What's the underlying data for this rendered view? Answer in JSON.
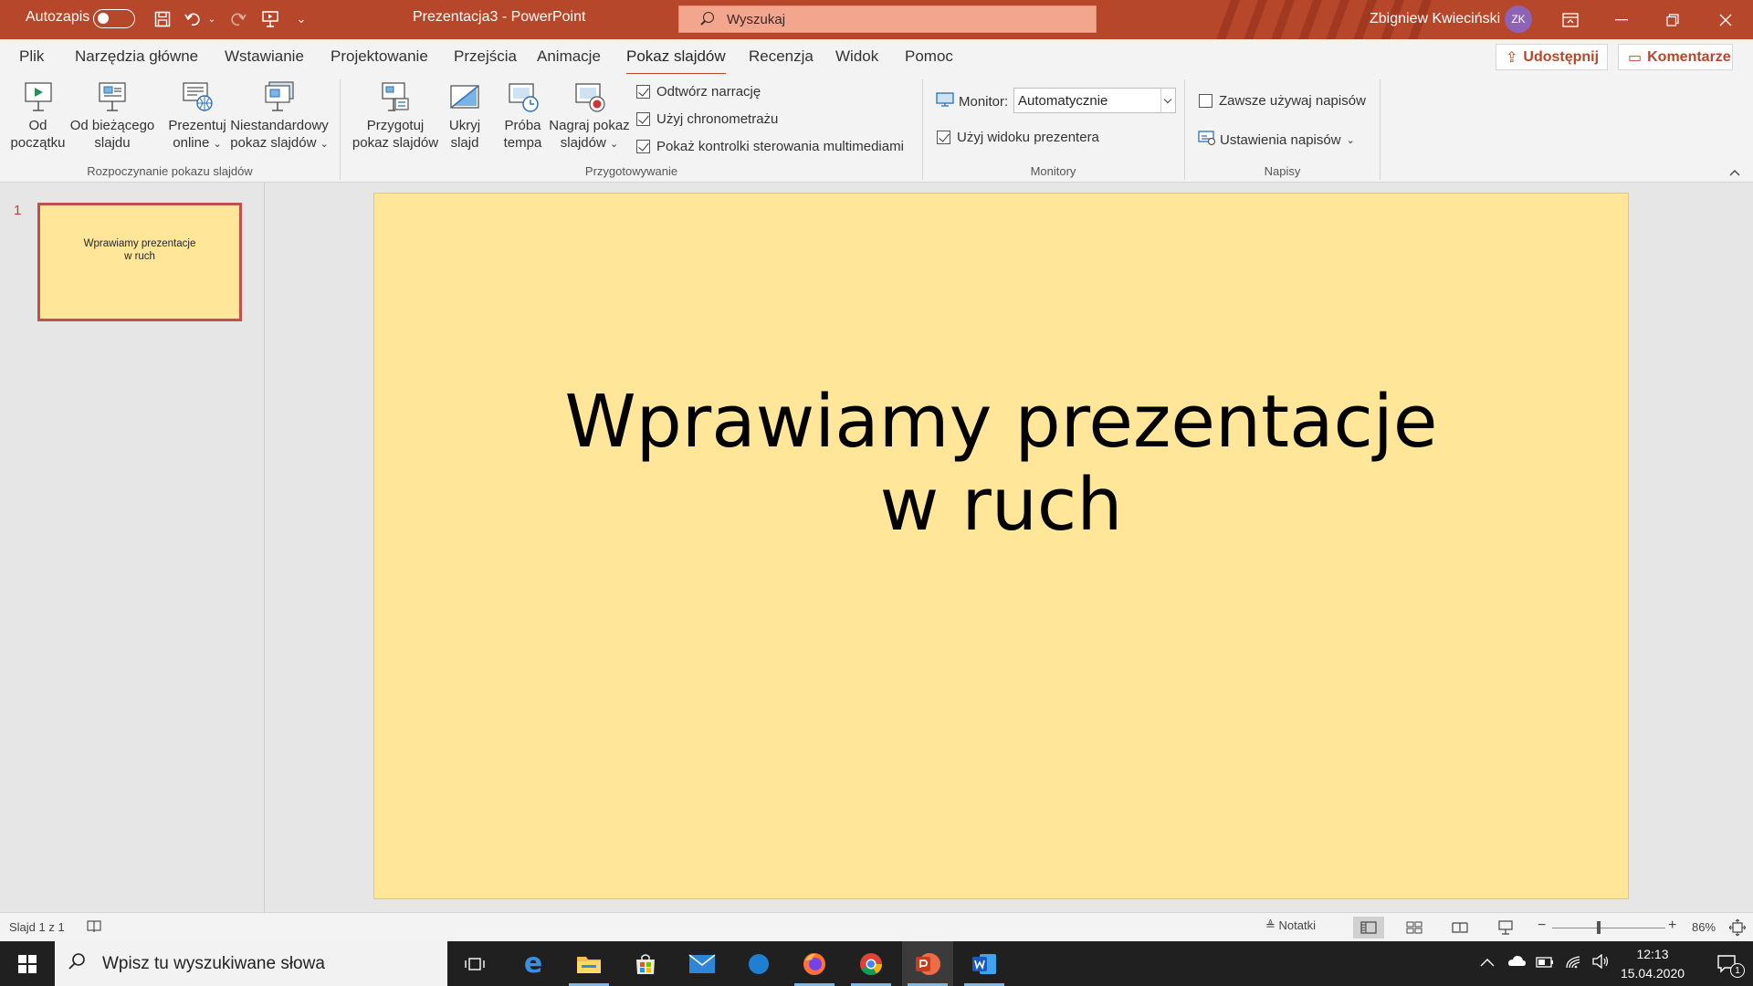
{
  "titlebar": {
    "autosave_label": "Autozapis",
    "document_title": "Prezentacja3  -  PowerPoint",
    "search_placeholder": "Wyszukaj",
    "user_name": "Zbigniew Kwieciński",
    "user_initials": "ZK",
    "accent_color": "#b7472a"
  },
  "tabs": [
    "Plik",
    "Narzędzia główne",
    "Wstawianie",
    "Projektowanie",
    "Przejścia",
    "Animacje",
    "Pokaz slajdów",
    "Recenzja",
    "Widok",
    "Pomoc"
  ],
  "active_tab": "Pokaz slajdów",
  "share_label": "Udostępnij",
  "comments_label": "Komentarze",
  "ribbon": {
    "start_group": {
      "label": "Rozpoczynanie pokazu slajdów",
      "from_beginning": [
        "Od",
        "początku"
      ],
      "from_current": [
        "Od bieżącego",
        "slajdu"
      ],
      "present_online": [
        "Prezentuj",
        "online"
      ],
      "custom_show": [
        "Niestandardowy",
        "pokaz slajdów"
      ]
    },
    "setup_group": {
      "label": "Przygotowywanie",
      "setup_show": [
        "Przygotuj",
        "pokaz slajdów"
      ],
      "hide_slide": [
        "Ukryj",
        "slajd"
      ],
      "rehearse": [
        "Próba",
        "tempa"
      ],
      "record": [
        "Nagraj pokaz",
        "slajdów"
      ],
      "play_narrations": "Odtwórz narrację",
      "use_timings": "Użyj chronometrażu",
      "show_media_controls": "Pokaż kontrolki sterowania multimediami"
    },
    "monitors_group": {
      "label": "Monitory",
      "monitor_label": "Monitor:",
      "monitor_value": "Automatycznie",
      "presenter_view": "Użyj widoku prezentera"
    },
    "captions_group": {
      "label": "Napisy",
      "always_use": "Zawsze używaj napisów",
      "settings": "Ustawienia napisów"
    }
  },
  "slides": [
    {
      "number": "1",
      "title_line1": "Wprawiamy prezentacje",
      "title_line2": "w ruch"
    }
  ],
  "slide_background": "#ffe699",
  "statusbar": {
    "slide_info": "Slajd 1 z 1",
    "notes_label": "Notatki",
    "zoom": "86%"
  },
  "taskbar": {
    "search_placeholder": "Wpisz tu wyszukiwane słowa",
    "time": "12:13",
    "date": "15.04.2020",
    "notifications": "1"
  }
}
